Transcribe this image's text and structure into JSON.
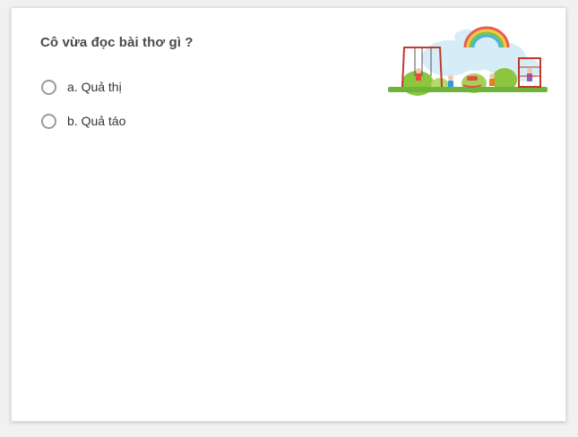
{
  "question": {
    "text": "Cô vừa đọc bài thơ gì ?"
  },
  "options": [
    {
      "label": "a. Quả thị",
      "selected": false
    },
    {
      "label": "b. Quả táo",
      "selected": false
    }
  ],
  "illustration": {
    "icon": "playground-illustration",
    "colors": {
      "grass": "#6fb43a",
      "cloud": "#d6ecf7",
      "rainbow_red": "#e85a4f",
      "rainbow_yellow": "#f6c744",
      "rainbow_green": "#7cc242",
      "rainbow_blue": "#4ab0e3",
      "swing_frame": "#c0392b"
    }
  }
}
